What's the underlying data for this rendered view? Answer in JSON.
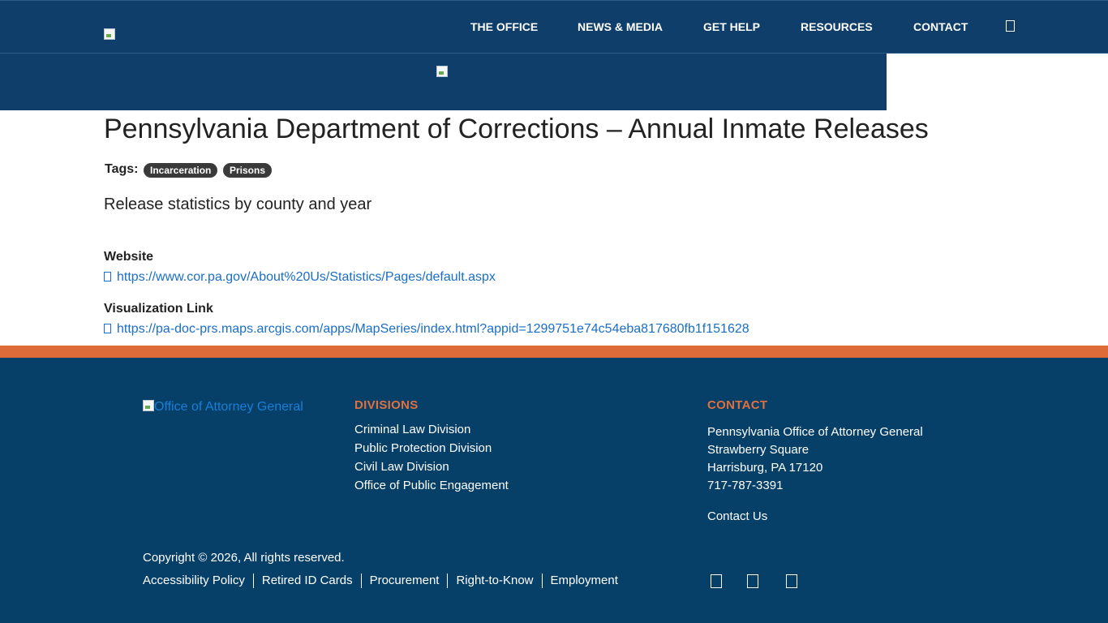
{
  "header": {
    "nav": [
      "THE OFFICE",
      "NEWS & MEDIA",
      "GET HELP",
      "RESOURCES",
      "CONTACT"
    ],
    "search_icon": "search-icon",
    "logo_icon": "broken-image-icon"
  },
  "page": {
    "title": "Pennsylvania Department of Corrections – Annual Inmate Releases",
    "tags_label": "Tags:",
    "tags": [
      "Incarceration",
      "Prisons"
    ],
    "description": "Release statistics by county and year",
    "website_label": "Website",
    "website_url": "https://www.cor.pa.gov/About%20Us/Statistics/Pages/default.aspx",
    "viz_label": "Visualization Link",
    "viz_url": "https://pa-doc-prs.maps.arcgis.com/apps/MapSeries/index.html?appid=1299751e74c54eba817680fb1f151628"
  },
  "footer": {
    "logo_alt": "Office of Attorney General",
    "divisions_heading": "DIVISIONS",
    "divisions": [
      "Criminal Law Division",
      "Public Protection Division",
      "Civil Law Division",
      "Office of Public Engagement"
    ],
    "contact_heading": "CONTACT",
    "contact_lines": [
      "Pennsylvania Office of Attorney General",
      "Strawberry Square",
      "Harrisburg, PA 17120",
      "717-787-3391"
    ],
    "contact_us": "Contact Us",
    "copyright": "Copyright © 2026, All rights reserved.",
    "bottom_links": [
      "Accessibility Policy",
      "Retired ID Cards",
      "Procurement",
      "Right-to-Know",
      "Employment"
    ],
    "social_icons": [
      "facebook-icon",
      "twitter-icon",
      "youtube-icon"
    ]
  },
  "colors": {
    "navy": "#0f3e6a",
    "footer_navy": "#063f68",
    "orange": "#dd6a39",
    "link_blue": "#1a6ec6"
  }
}
